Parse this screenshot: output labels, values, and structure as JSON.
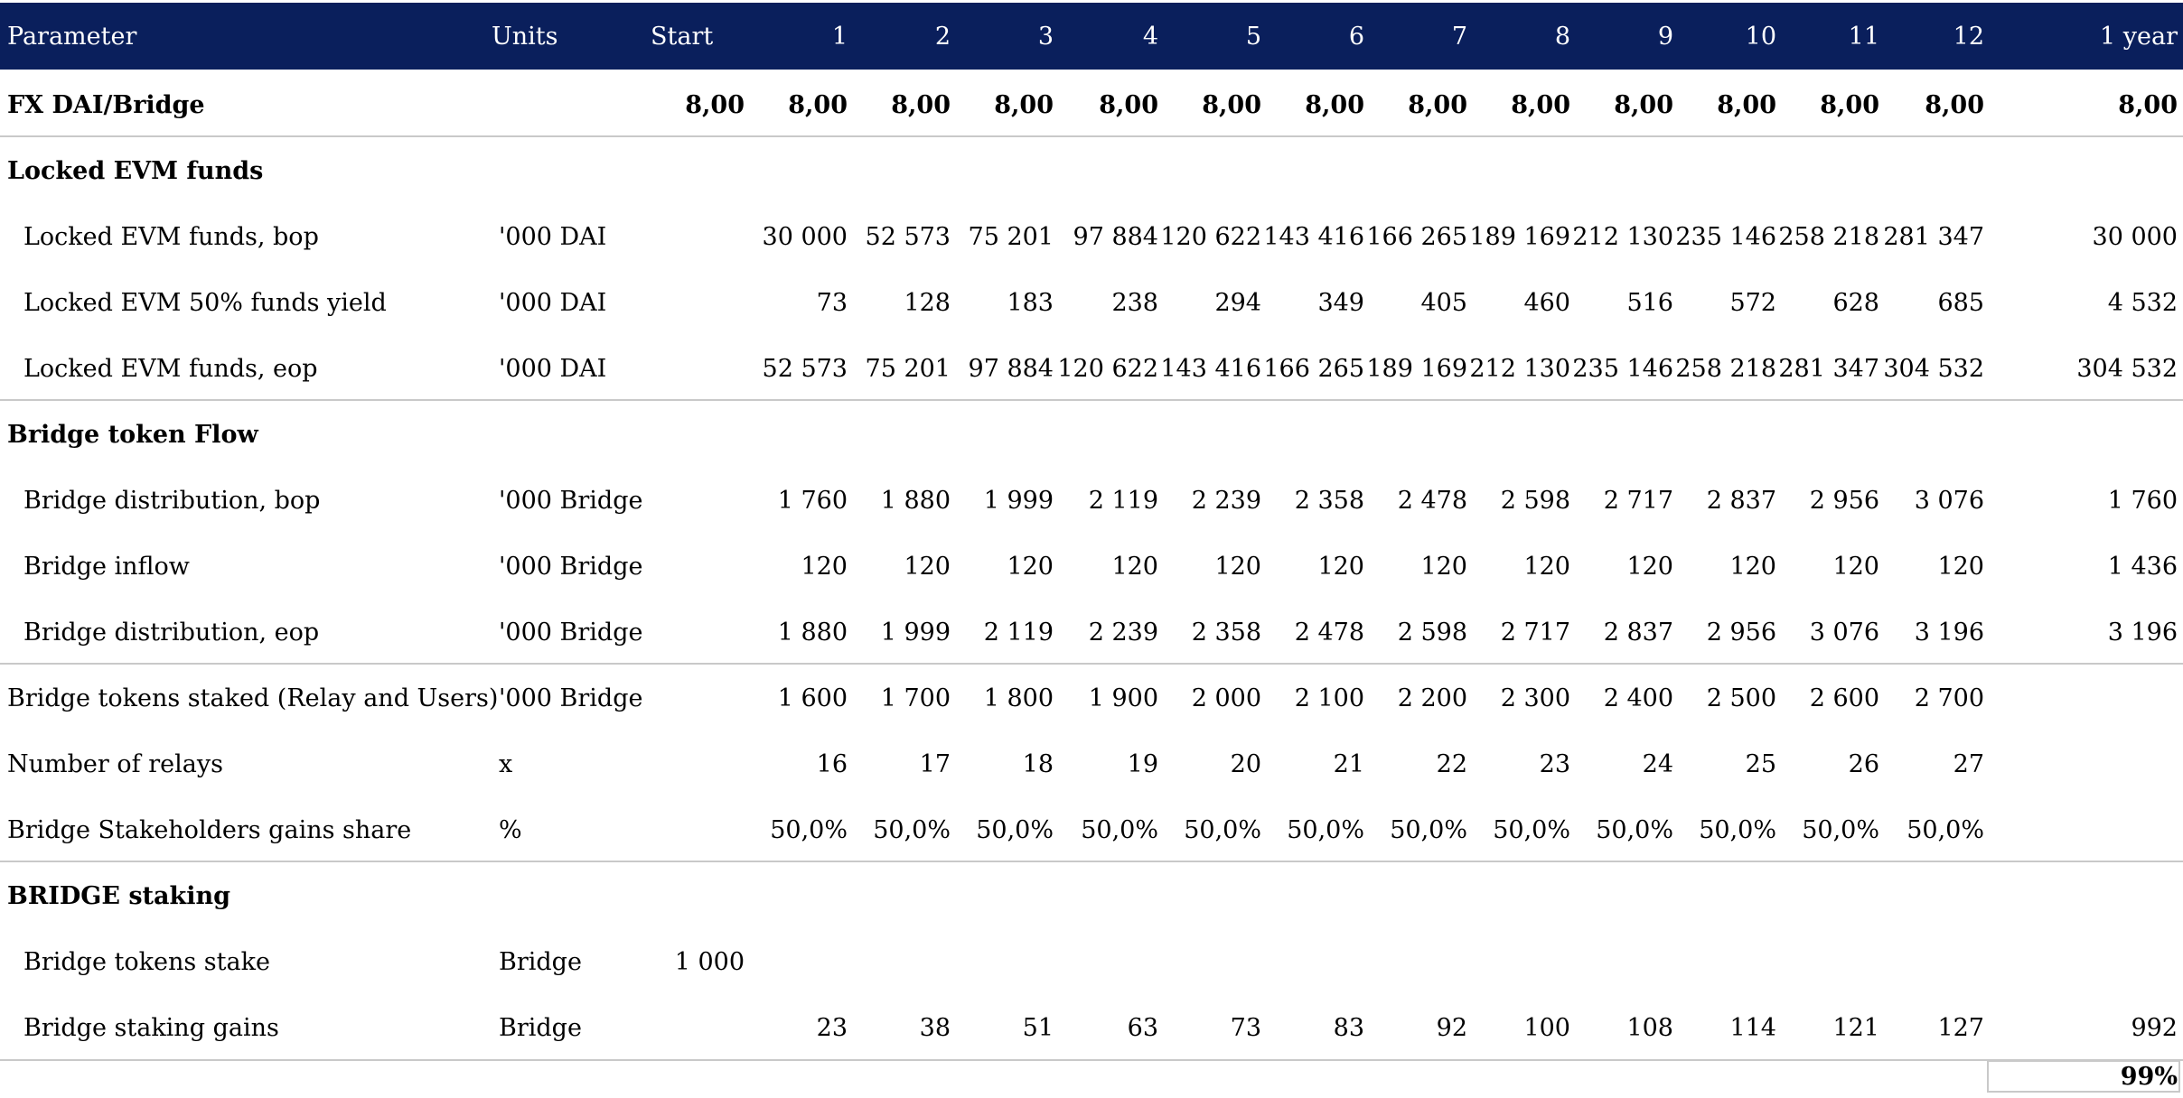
{
  "header": {
    "parameter": "Parameter",
    "units": "Units",
    "start": "Start",
    "periods": [
      "1",
      "2",
      "3",
      "4",
      "5",
      "6",
      "7",
      "8",
      "9",
      "10",
      "11",
      "12"
    ],
    "total": "1 year"
  },
  "rows": [
    {
      "label": "FX DAI/Bridge",
      "units": "",
      "start": "8,00",
      "values": [
        "8,00",
        "8,00",
        "8,00",
        "8,00",
        "8,00",
        "8,00",
        "8,00",
        "8,00",
        "8,00",
        "8,00",
        "8,00",
        "8,00"
      ],
      "total": "8,00"
    },
    {
      "label": "Locked EVM funds",
      "units": "",
      "start": "",
      "values": [
        "",
        "",
        "",
        "",
        "",
        "",
        "",
        "",
        "",
        "",
        "",
        ""
      ],
      "total": ""
    },
    {
      "label": "Locked EVM funds, bop",
      "units": "'000 DAI",
      "start": "",
      "values": [
        "30 000",
        "52 573",
        "75 201",
        "97 884",
        "120 622",
        "143 416",
        "166 265",
        "189 169",
        "212 130",
        "235 146",
        "258 218",
        "281 347"
      ],
      "total": "30 000"
    },
    {
      "label": "Locked EVM 50% funds yield",
      "units": "'000 DAI",
      "start": "",
      "values": [
        "73",
        "128",
        "183",
        "238",
        "294",
        "349",
        "405",
        "460",
        "516",
        "572",
        "628",
        "685"
      ],
      "total": "4 532"
    },
    {
      "label": "Locked EVM funds, eop",
      "units": "'000 DAI",
      "start": "",
      "values": [
        "52 573",
        "75 201",
        "97 884",
        "120 622",
        "143 416",
        "166 265",
        "189 169",
        "212 130",
        "235 146",
        "258 218",
        "281 347",
        "304 532"
      ],
      "total": "304 532"
    },
    {
      "label": "Bridge token Flow",
      "units": "",
      "start": "",
      "values": [
        "",
        "",
        "",
        "",
        "",
        "",
        "",
        "",
        "",
        "",
        "",
        ""
      ],
      "total": ""
    },
    {
      "label": "Bridge distribution, bop",
      "units": "'000 Bridge",
      "start": "",
      "values": [
        "1 760",
        "1 880",
        "1 999",
        "2 119",
        "2 239",
        "2 358",
        "2 478",
        "2 598",
        "2 717",
        "2 837",
        "2 956",
        "3 076"
      ],
      "total": "1 760"
    },
    {
      "label": "Bridge inflow",
      "units": "'000 Bridge",
      "start": "",
      "values": [
        "120",
        "120",
        "120",
        "120",
        "120",
        "120",
        "120",
        "120",
        "120",
        "120",
        "120",
        "120"
      ],
      "total": "1 436"
    },
    {
      "label": "Bridge distribution, eop",
      "units": "'000 Bridge",
      "start": "",
      "values": [
        "1 880",
        "1 999",
        "2 119",
        "2 239",
        "2 358",
        "2 478",
        "2 598",
        "2 717",
        "2 837",
        "2 956",
        "3 076",
        "3 196"
      ],
      "total": "3 196"
    },
    {
      "label": "Bridge tokens staked (Relay and Users)",
      "units": "'000 Bridge",
      "start": "",
      "values": [
        "1 600",
        "1 700",
        "1 800",
        "1 900",
        "2 000",
        "2 100",
        "2 200",
        "2 300",
        "2 400",
        "2 500",
        "2 600",
        "2 700"
      ],
      "total": ""
    },
    {
      "label": "Number of relays",
      "units": "x",
      "start": "",
      "values": [
        "16",
        "17",
        "18",
        "19",
        "20",
        "21",
        "22",
        "23",
        "24",
        "25",
        "26",
        "27"
      ],
      "total": ""
    },
    {
      "label": "Bridge Stakeholders gains share",
      "units": "%",
      "start": "",
      "values": [
        "50,0%",
        "50,0%",
        "50,0%",
        "50,0%",
        "50,0%",
        "50,0%",
        "50,0%",
        "50,0%",
        "50,0%",
        "50,0%",
        "50,0%",
        "50,0%"
      ],
      "total": ""
    },
    {
      "label": "BRIDGE staking",
      "units": "",
      "start": "",
      "values": [
        "",
        "",
        "",
        "",
        "",
        "",
        "",
        "",
        "",
        "",
        "",
        ""
      ],
      "total": ""
    },
    {
      "label": "Bridge tokens stake",
      "units": "Bridge",
      "start": "1 000",
      "values": [
        "",
        "",
        "",
        "",
        "",
        "",
        "",
        "",
        "",
        "",
        "",
        ""
      ],
      "total": ""
    },
    {
      "label": "Bridge staking gains",
      "units": "Bridge",
      "start": "",
      "values": [
        "23",
        "38",
        "51",
        "63",
        "73",
        "83",
        "92",
        "100",
        "108",
        "114",
        "121",
        "127"
      ],
      "total": "992"
    }
  ],
  "footer": {
    "percent": "99%"
  }
}
